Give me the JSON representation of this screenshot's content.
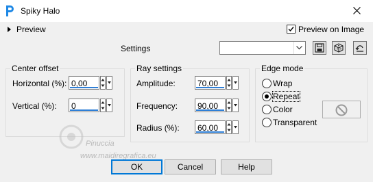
{
  "window": {
    "title": "Spiky Halo",
    "close_icon": "close-icon"
  },
  "preview": {
    "label": "Preview",
    "preview_on_image_label": "Preview on Image",
    "preview_on_image_checked": true
  },
  "settings": {
    "label": "Settings",
    "value": ""
  },
  "toolbar": {
    "icons": [
      "save-icon",
      "3d-box-icon",
      "reset-icon"
    ]
  },
  "center_offset": {
    "title": "Center offset",
    "horizontal_label": "Horizontal (%):",
    "horizontal_value": "0,00",
    "vertical_label": "Vertical (%):",
    "vertical_value": "0"
  },
  "ray_settings": {
    "title": "Ray settings",
    "amplitude_label": "Amplitude:",
    "amplitude_value": "70,00",
    "frequency_label": "Frequency:",
    "frequency_value": "90,00",
    "radius_label": "Radius (%):",
    "radius_value": "60,00"
  },
  "edge_mode": {
    "title": "Edge mode",
    "options": [
      "Wrap",
      "Repeat",
      "Color",
      "Transparent"
    ],
    "selected": "Repeat"
  },
  "watermark": {
    "line1": "Pinuccia",
    "line2": "www.maidiregrafica.eu"
  },
  "buttons": {
    "ok": "OK",
    "cancel": "Cancel",
    "help": "Help"
  },
  "colors": {
    "accent": "#2f7fd6",
    "focus": "#0078d7",
    "dialog_bg": "#f0f0f0"
  }
}
